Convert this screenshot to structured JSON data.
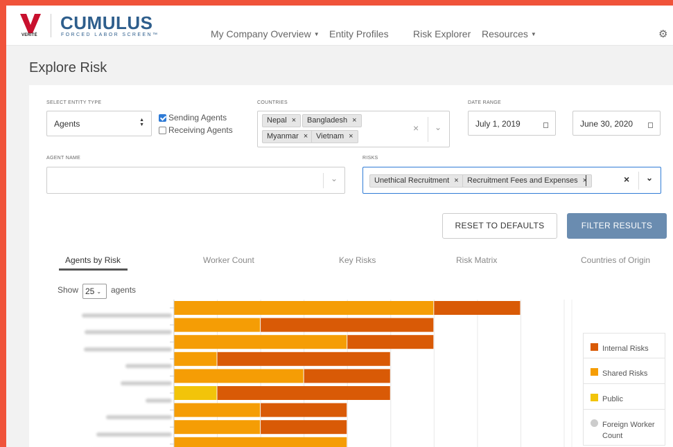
{
  "logo": {
    "brand_mark": "VERITÉ",
    "title": "CUMULUS",
    "subtitle": "FORCED LABOR SCREEN™"
  },
  "nav": {
    "items": [
      {
        "label": "My Company Overview",
        "dropdown": true
      },
      {
        "label": "Entity Profiles",
        "dropdown": false
      },
      {
        "label": "Risk Explorer",
        "dropdown": false
      },
      {
        "label": "Resources",
        "dropdown": true
      }
    ]
  },
  "page_title": "Explore Risk",
  "filters": {
    "entity_type": {
      "label": "SELECT ENTITY TYPE",
      "value": "Agents"
    },
    "sending_agents": {
      "label": "Sending Agents",
      "checked": true
    },
    "receiving_agents": {
      "label": "Receiving Agents",
      "checked": false
    },
    "countries": {
      "label": "COUNTRIES",
      "tags": [
        "Nepal",
        "Bangladesh",
        "Myanmar",
        "Vietnam"
      ]
    },
    "date_range": {
      "label": "DATE RANGE",
      "start": "July 1, 2019",
      "end": "June 30, 2020"
    },
    "agent_name": {
      "label": "AGENT NAME",
      "value": ""
    },
    "risks": {
      "label": "RISKS",
      "tags": [
        "Unethical Recruitment",
        "Recruitment Fees and Expenses"
      ]
    }
  },
  "buttons": {
    "reset": "RESET TO DEFAULTS",
    "filter": "FILTER RESULTS"
  },
  "tabs": [
    "Agents by Risk",
    "Worker Count",
    "Key Risks",
    "Risk Matrix",
    "Countries of Origin"
  ],
  "active_tab": 0,
  "show": {
    "label": "Show",
    "value": "25",
    "suffix": "agents"
  },
  "legend": [
    {
      "label": "Internal Risks",
      "color": "#d95a06",
      "shape": "square"
    },
    {
      "label": "Shared Risks",
      "color": "#f59d05",
      "shape": "square"
    },
    {
      "label": "Public",
      "color": "#f2c40a",
      "shape": "square"
    },
    {
      "label": "Foreign Worker Count",
      "color": "#cccccc",
      "shape": "circle"
    }
  ],
  "chart_data": {
    "type": "bar",
    "orientation": "horizontal",
    "stacked": true,
    "categories": [
      "",
      "",
      "",
      "",
      "",
      "",
      "",
      "",
      ""
    ],
    "series": [
      {
        "name": "Public",
        "color": "#f2c40a",
        "values": [
          0,
          0,
          0,
          0,
          0,
          1,
          0,
          0,
          0
        ]
      },
      {
        "name": "Shared Risks",
        "color": "#f59d05",
        "values": [
          6,
          2,
          4,
          1,
          3,
          0,
          2,
          2,
          4
        ]
      },
      {
        "name": "Internal Risks",
        "color": "#d95a06",
        "values": [
          2,
          4,
          2,
          4,
          2,
          4,
          2,
          2,
          0
        ]
      }
    ],
    "xlim": [
      0,
      9
    ],
    "grid": true,
    "legend_position": "right"
  }
}
